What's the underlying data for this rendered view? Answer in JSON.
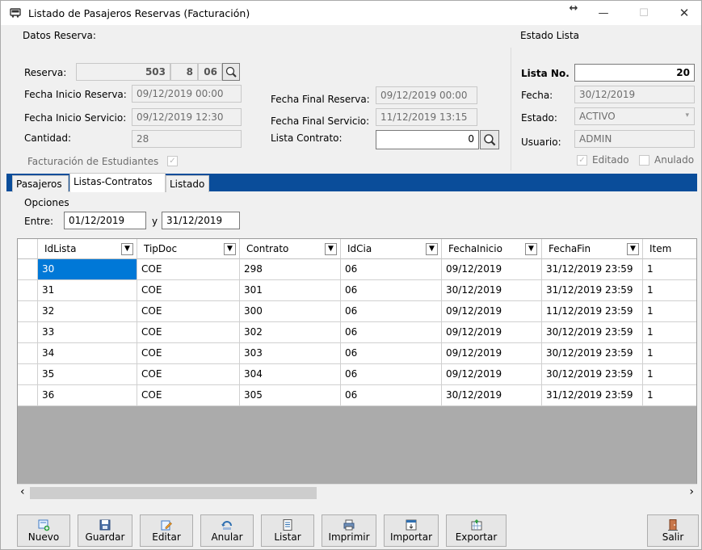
{
  "window": {
    "title": "Listado de Pasajeros Reservas (Facturación)",
    "resize_glyph": "↔",
    "minimize_glyph": "—",
    "maximize_glyph": "☐",
    "close_glyph": "✕"
  },
  "datos": {
    "group_title": "Datos Reserva:",
    "reserva_label": "Reserva:",
    "reserva_1": "503",
    "reserva_2": "8",
    "reserva_3": "06",
    "fecha_inicio_reserva_label": "Fecha Inicio Reserva:",
    "fecha_inicio_reserva": "09/12/2019 00:00",
    "fecha_inicio_servicio_label": "Fecha Inicio Servicio:",
    "fecha_inicio_servicio": "09/12/2019 12:30",
    "cantidad_label": "Cantidad:",
    "cantidad": "28",
    "facturacion_label": "Facturación de Estudiantes",
    "fecha_final_reserva_label": "Fecha Final Reserva:",
    "fecha_final_reserva": "09/12/2019 00:00",
    "fecha_final_servicio_label": "Fecha Final Servicio:",
    "fecha_final_servicio": "11/12/2019 13:15",
    "lista_contrato_label": "Lista Contrato:",
    "lista_contrato": "0"
  },
  "estado": {
    "group_title": "Estado Lista",
    "lista_no_label": "Lista No.",
    "lista_no": "20",
    "fecha_label": "Fecha:",
    "fecha": "30/12/2019",
    "estado_label": "Estado:",
    "estado": "ACTIVO",
    "usuario_label": "Usuario:",
    "usuario": "ADMIN",
    "editado_label": "Editado",
    "anulado_label": "Anulado"
  },
  "tabs": [
    "Pasajeros",
    "Listas-Contratos",
    "Listado"
  ],
  "opciones": {
    "title": "Opciones",
    "entre_label": "Entre:",
    "desde": "01/12/2019",
    "y_label": "y",
    "hasta": "31/12/2019"
  },
  "grid": {
    "columns": [
      "IdLista",
      "TipDoc",
      "Contrato",
      "IdCia",
      "FechaInicio",
      "FechaFin",
      "Item"
    ],
    "rows": [
      [
        "30",
        "COE",
        "298",
        "06",
        "09/12/2019",
        "31/12/2019 23:59",
        "1"
      ],
      [
        "31",
        "COE",
        "301",
        "06",
        "30/12/2019",
        "31/12/2019 23:59",
        "1"
      ],
      [
        "32",
        "COE",
        "300",
        "06",
        "09/12/2019",
        "11/12/2019 23:59",
        "1"
      ],
      [
        "33",
        "COE",
        "302",
        "06",
        "09/12/2019",
        "30/12/2019 23:59",
        "1"
      ],
      [
        "34",
        "COE",
        "303",
        "06",
        "09/12/2019",
        "30/12/2019 23:59",
        "1"
      ],
      [
        "35",
        "COE",
        "304",
        "06",
        "09/12/2019",
        "30/12/2019 23:59",
        "1"
      ],
      [
        "36",
        "COE",
        "305",
        "06",
        "30/12/2019",
        "31/12/2019 23:59",
        "1"
      ]
    ]
  },
  "toolbar": {
    "nuevo": "Nuevo",
    "guardar": "Guardar",
    "editar": "Editar",
    "anular": "Anular",
    "listar": "Listar",
    "imprimir": "Imprimir",
    "importar": "Importar",
    "exportar": "Exportar",
    "salir": "Salir"
  },
  "scroll": {
    "left_arrow": "‹",
    "right_arrow": "›"
  },
  "colors": {
    "tab_bar": "#0a4d9a",
    "selection": "#0078d7"
  }
}
